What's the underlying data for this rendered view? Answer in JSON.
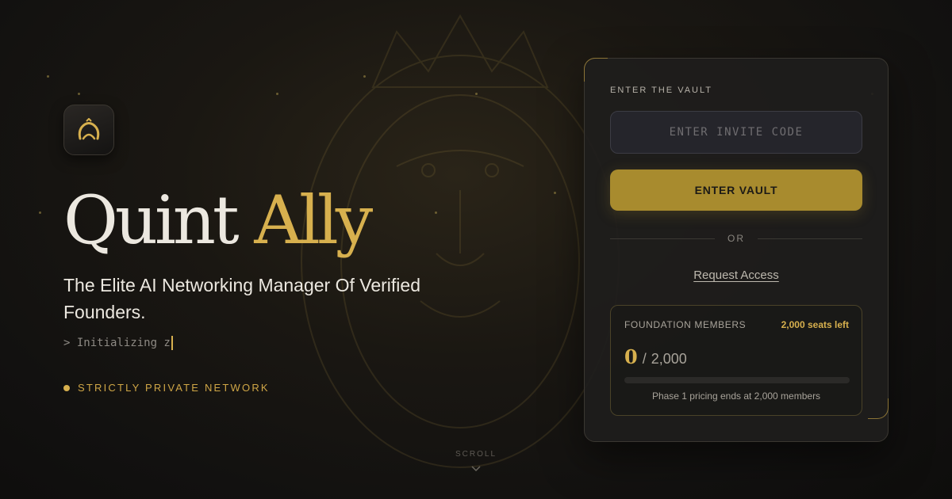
{
  "brand": {
    "logo_icon": "crown-a-monogram",
    "name_part1": "Quint",
    "name_part2": "Ally",
    "accent_color": "#d7b04e"
  },
  "hero": {
    "tagline": "The Elite AI Networking Manager Of Verified Founders.",
    "terminal_text": "> Initializing z",
    "private_label": "STRICTLY PRIVATE NETWORK"
  },
  "scroll": {
    "label": "SCROLL",
    "icon": "chevron-down-icon"
  },
  "vault": {
    "title": "ENTER THE VAULT",
    "invite_placeholder": "ENTER INVITE CODE",
    "enter_button": "ENTER VAULT",
    "or_label": "OR",
    "request_access": "Request Access",
    "members": {
      "title": "FOUNDATION MEMBERS",
      "seats_left": "2,000 seats left",
      "current": "0",
      "separator": "/",
      "total": "2,000",
      "progress_fraction": 0,
      "note": "Phase 1 pricing ends at 2,000 members"
    }
  }
}
